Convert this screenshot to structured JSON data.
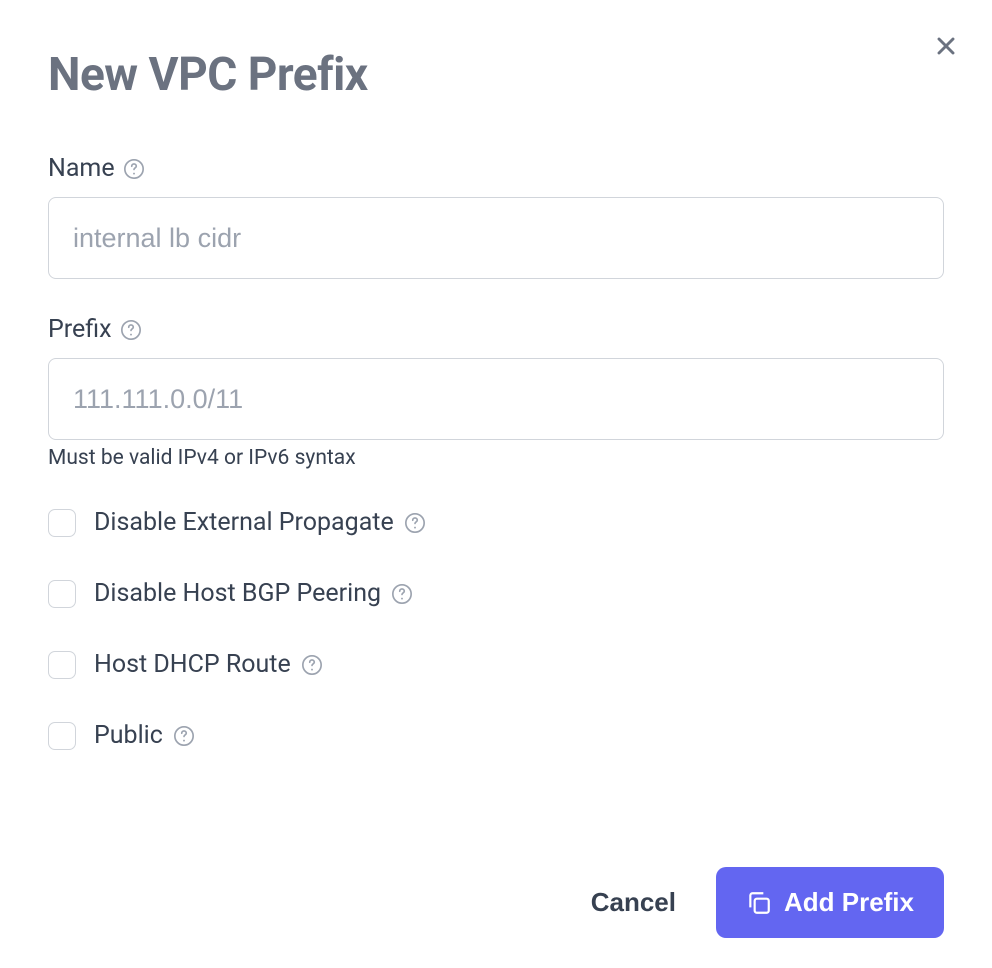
{
  "dialog": {
    "title": "New VPC Prefix"
  },
  "fields": {
    "name": {
      "label": "Name",
      "placeholder": "internal lb cidr"
    },
    "prefix": {
      "label": "Prefix",
      "placeholder": "111.111.0.0/11",
      "help_text": "Must be valid IPv4 or IPv6 syntax"
    }
  },
  "checkboxes": {
    "disable_external_propagate": {
      "label": "Disable External Propagate"
    },
    "disable_host_bgp_peering": {
      "label": "Disable Host BGP Peering"
    },
    "host_dhcp_route": {
      "label": "Host DHCP Route"
    },
    "public": {
      "label": "Public"
    }
  },
  "buttons": {
    "cancel": "Cancel",
    "submit": "Add Prefix"
  }
}
